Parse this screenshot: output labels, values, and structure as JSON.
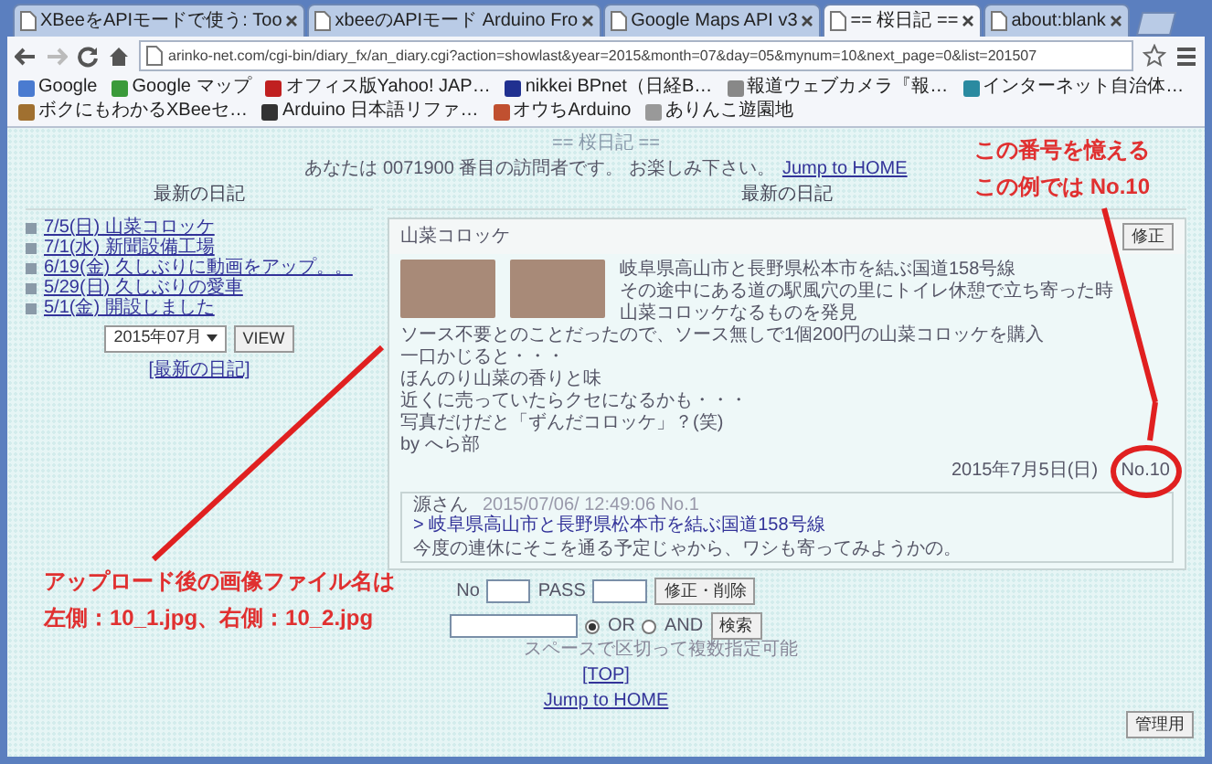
{
  "browser": {
    "tabs": [
      {
        "label": "XBeeをAPIモードで使う: Too",
        "selected": false
      },
      {
        "label": "xbeeのAPIモード Arduino Fro",
        "selected": false
      },
      {
        "label": "Google Maps API v3",
        "selected": false
      },
      {
        "label": "== 桜日記 ==",
        "selected": true
      },
      {
        "label": "about:blank",
        "selected": false
      }
    ],
    "url": "arinko-net.com/cgi-bin/diary_fx/an_diary.cgi?action=showlast&year=2015&month=07&day=05&mynum=10&next_page=0&list=201507",
    "bookmarks": [
      "Google",
      "Google マップ",
      "オフィス版Yahoo! JAP…",
      "nikkei BPnet（日経B…",
      "報道ウェブカメラ『報…",
      "インターネット自治体…",
      "ボクにもわかるXBeeセ…",
      "Arduino 日本語リファ…",
      "オウちArduino",
      "ありんこ遊園地"
    ]
  },
  "page": {
    "title": "== 桜日記 ==",
    "visitor_text": "あなたは 0071900 番目の訪問者です。 お楽しみ下さい。",
    "home_link": "Jump to HOME",
    "left_heading": "最新の日記",
    "right_heading": "最新の日記",
    "recent_entries": [
      "7/5(日) 山菜コロッケ",
      "7/1(水) 新聞設備工場",
      "6/19(金) 久しぶりに動画をアップ。。",
      "5/29(日) 久しぶりの愛車",
      "5/1(金) 開設しました"
    ],
    "month_select": "2015年07月",
    "view_button": "VIEW",
    "latest_link": "[最新の日記]",
    "entry": {
      "title": "山菜コロッケ",
      "edit_button": "修正",
      "beside_photos": [
        "岐阜県高山市と長野県松本市を結ぶ国道158号線",
        "その途中にある道の駅風穴の里にトイレ休憩で立ち寄った時",
        "山菜コロッケなるものを発見"
      ],
      "body": [
        "ソース不要とのことだったので、ソース無しで1個200円の山菜コロッケを購入",
        "一口かじると・・・",
        "ほんのり山菜の香りと味",
        "近くに売っていたらクセになるかも・・・",
        "写真だけだと「ずんだコロッケ」？(笑)",
        "by へら部"
      ],
      "footer": "2015年7月5日(日) No.10",
      "comment": {
        "author": "源さん",
        "meta": "2015/07/06/ 12:49:06 No.1",
        "quote": "> 岐阜県高山市と長野県松本市を結ぶ国道158号線",
        "text": "今度の連休にそこを通る予定じゃから、ワシも寄ってみようかの。"
      }
    },
    "edit_form": {
      "no_label": "No",
      "pass_label": "PASS",
      "button": "修正・削除"
    },
    "search": {
      "options": [
        {
          "label": "OR",
          "selected": true
        },
        {
          "label": "AND",
          "selected": false
        }
      ],
      "button": "検索",
      "hint": "スペースで区切って複数指定可能"
    },
    "top_link": "[TOP]",
    "home_link_bottom": "Jump to HOME",
    "admin_button": "管理用"
  },
  "annotations": [
    {
      "lines": [
        "この番号を憶える",
        "この例では No.10"
      ]
    },
    {
      "lines": [
        "アップロード後の画像ファイル名は",
        "左側：10_1.jpg、右側：10_2.jpg"
      ]
    }
  ]
}
